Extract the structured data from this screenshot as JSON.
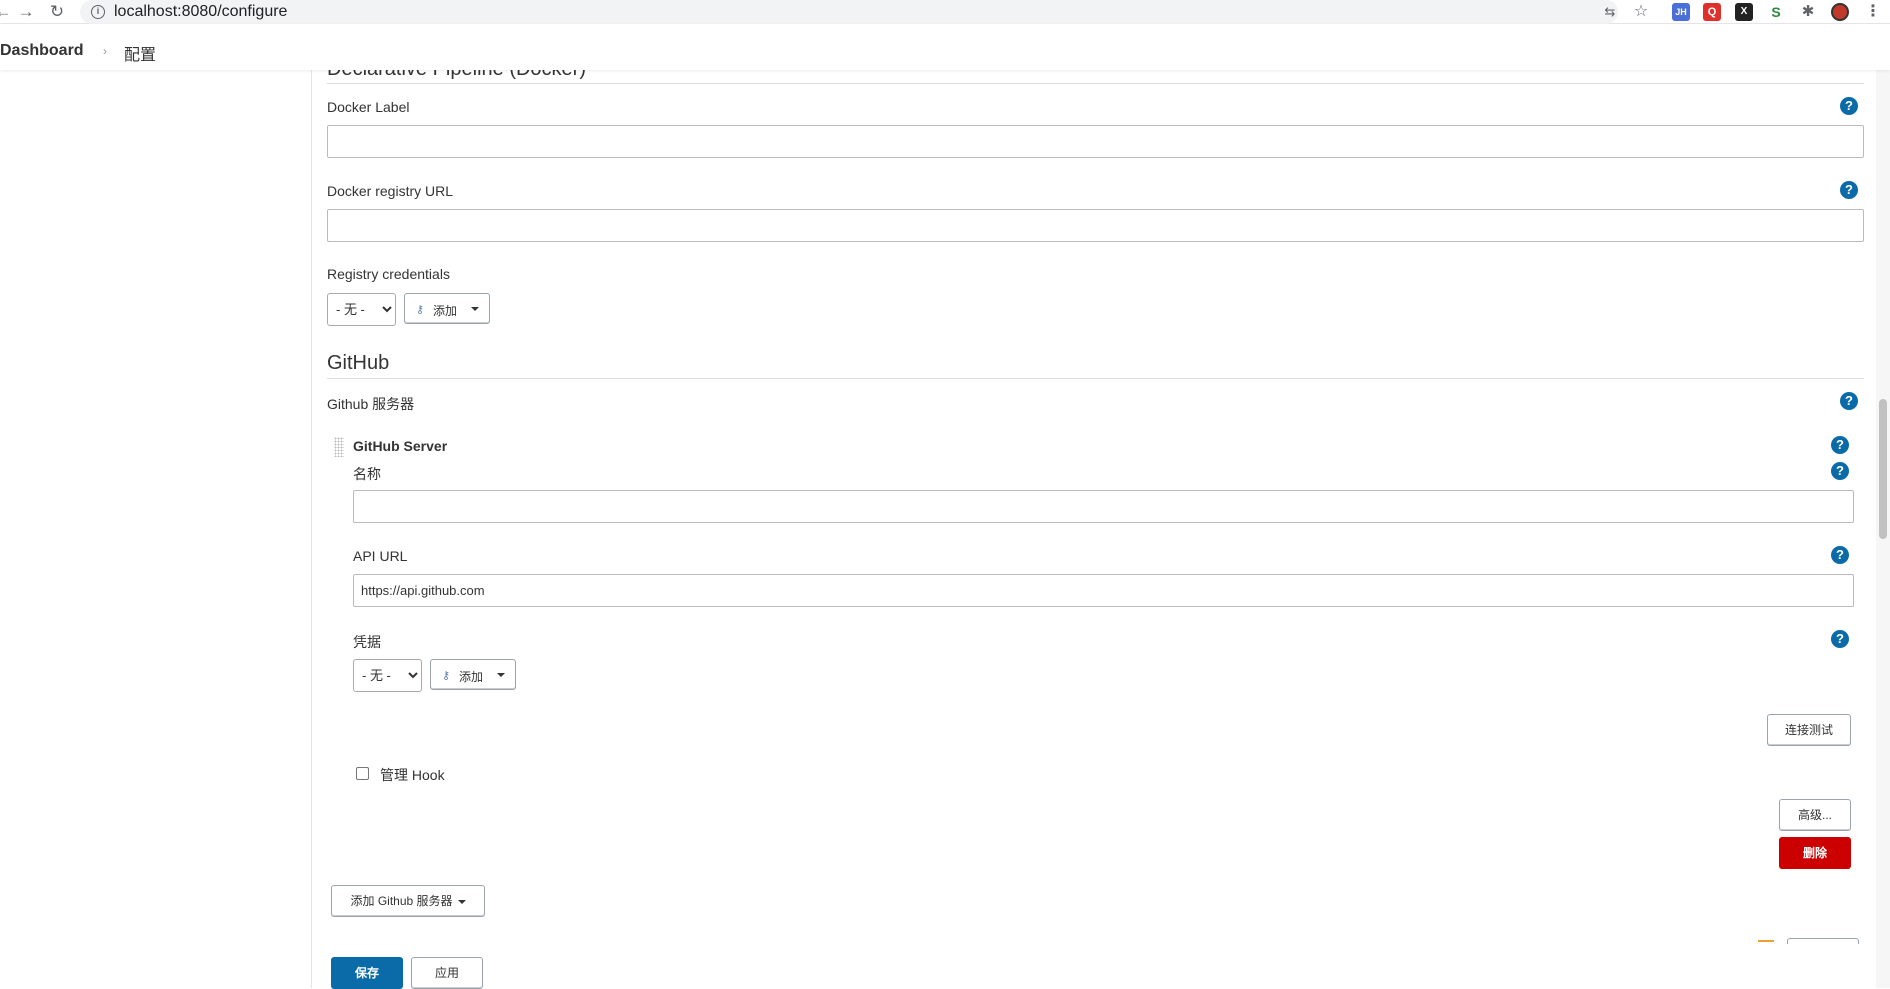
{
  "browser": {
    "url": "localhost:8080/configure",
    "extensions": [
      "JH",
      "Q",
      "X",
      "S"
    ]
  },
  "breadcrumb": {
    "home": "Dashboard",
    "current": "配置"
  },
  "pipeline_section": {
    "title": "Declarative Pipeline (Docker)",
    "docker_label": {
      "label": "Docker Label",
      "value": ""
    },
    "docker_registry_url": {
      "label": "Docker registry URL",
      "value": ""
    },
    "registry_credentials": {
      "label": "Registry credentials",
      "selected": "- 无 -",
      "add_label": "添加"
    }
  },
  "github_section": {
    "title": "GitHub",
    "servers_label": "Github 服务器",
    "server": {
      "header": "GitHub Server",
      "name": {
        "label": "名称",
        "value": ""
      },
      "api_url": {
        "label": "API URL",
        "value": "https://api.github.com"
      },
      "credentials": {
        "label": "凭据",
        "selected": "- 无 -",
        "add_label": "添加"
      },
      "test_connection_label": "连接测试",
      "manage_hook_label": "管理 Hook",
      "manage_hook_checked": false,
      "advanced_label": "高级...",
      "delete_label": "删除"
    },
    "add_server_label": "添加 Github 服务器"
  },
  "footer": {
    "save_label": "保存",
    "apply_label": "应用"
  },
  "colors": {
    "help_icon": "#0b6ba8",
    "delete_button": "#cc0000",
    "save_button": "#0b6ba8"
  }
}
